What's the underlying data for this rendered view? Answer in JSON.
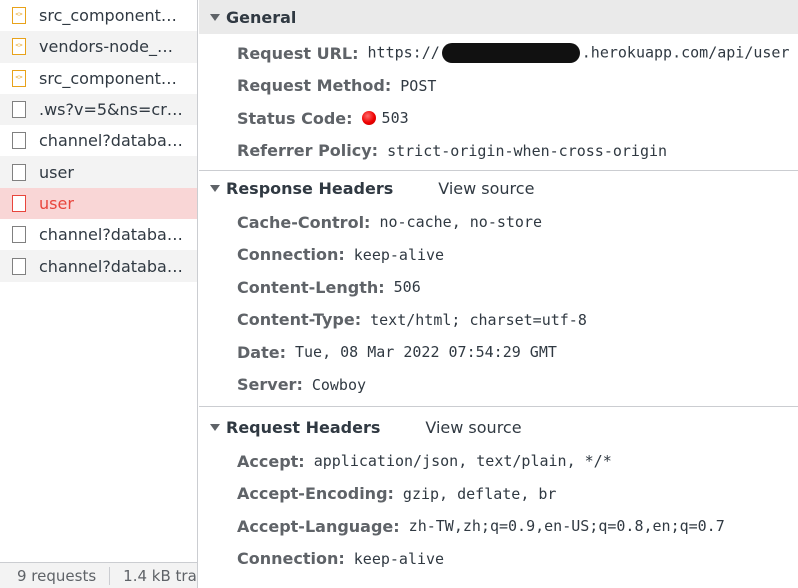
{
  "request_list": {
    "items": [
      {
        "name": "src_components_...",
        "icon": "js-file-icon"
      },
      {
        "name": "vendors-node_m...",
        "icon": "js-file-icon"
      },
      {
        "name": "src_components_...",
        "icon": "js-file-icon"
      },
      {
        "name": ".ws?v=5&ns=cra...",
        "icon": "document-icon"
      },
      {
        "name": "channel?databas...",
        "icon": "document-icon"
      },
      {
        "name": "user",
        "icon": "document-icon"
      },
      {
        "name": "user",
        "icon": "document-icon",
        "status": "error"
      },
      {
        "name": "channel?databas...",
        "icon": "document-icon"
      },
      {
        "name": "channel?databas...",
        "icon": "document-icon"
      }
    ],
    "footer": {
      "requests": "9 requests",
      "transferred": "1.4 kB tra"
    }
  },
  "general": {
    "title": "General",
    "request_url_label": "Request URL:",
    "request_url_prefix": "https://",
    "request_url_suffix": ".herokuapp.com/api/user",
    "request_method_label": "Request Method:",
    "request_method": "POST",
    "status_code_label": "Status Code:",
    "status_code": "503",
    "referrer_policy_label": "Referrer Policy:",
    "referrer_policy": "strict-origin-when-cross-origin"
  },
  "response_headers": {
    "title": "Response Headers",
    "view_source": "View source",
    "items": [
      {
        "key": "Cache-Control:",
        "value": "no-cache, no-store"
      },
      {
        "key": "Connection:",
        "value": "keep-alive"
      },
      {
        "key": "Content-Length:",
        "value": "506"
      },
      {
        "key": "Content-Type:",
        "value": "text/html; charset=utf-8"
      },
      {
        "key": "Date:",
        "value": "Tue, 08 Mar 2022 07:54:29 GMT"
      },
      {
        "key": "Server:",
        "value": "Cowboy"
      }
    ]
  },
  "request_headers": {
    "title": "Request Headers",
    "view_source": "View source",
    "items": [
      {
        "key": "Accept:",
        "value": "application/json, text/plain, */*"
      },
      {
        "key": "Accept-Encoding:",
        "value": "gzip, deflate, br"
      },
      {
        "key": "Accept-Language:",
        "value": "zh-TW,zh;q=0.9,en-US;q=0.8,en;q=0.7"
      },
      {
        "key": "Connection:",
        "value": "keep-alive"
      }
    ]
  },
  "colors": {
    "error_text": "#e8453c",
    "error_row_bg": "#f9d6d6",
    "js_icon": "#e8a21a",
    "status_dot": "#e00000"
  }
}
